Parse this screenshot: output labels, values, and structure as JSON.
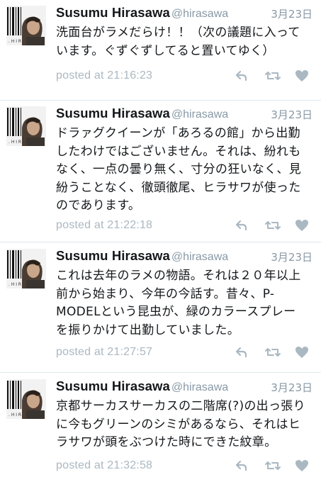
{
  "tweets": [
    {
      "name": "Susumu Hirasawa",
      "handle": "@hirasawa",
      "date": "3月23日",
      "lines": [
        "洗面台がラメだらけ！！（次の議題に入って",
        "います。ぐずぐずしてると置いてゆく）"
      ],
      "posted": "posted at 21:16:23"
    },
    {
      "name": "Susumu Hirasawa",
      "handle": "@hirasawa",
      "date": "3月23日",
      "lines": [
        "ドラァグクイーンが「あろるの館」から出勤",
        "したわけではございません。それは、紛れも",
        "なく、一点の曇り無く、寸分の狂いなく、見",
        "紛うことなく、徹頭徹尾、ヒラサワが使った",
        "のであります。"
      ],
      "posted": "posted at 21:22:18"
    },
    {
      "name": "Susumu Hirasawa",
      "handle": "@hirasawa",
      "date": "3月23日",
      "lines": [
        "これは去年のラメの物語。それは２０年以上",
        "前から始まり、今年の今話す。昔々、P-",
        "MODELという昆虫が、緑のカラースプレー",
        "を振りかけて出勤していました。"
      ],
      "posted": "posted at 21:27:57"
    },
    {
      "name": "Susumu Hirasawa",
      "handle": "@hirasawa",
      "date": "3月23日",
      "lines": [
        "京都サーカスサーカスの二階席(?)の出っ張り",
        "に今もグリーンのシミがあるなら、それはヒ",
        "ラサワが頭をぶつけた時にできた紋章。"
      ],
      "posted": "posted at 21:32:58"
    }
  ],
  "icons": {
    "avatar": "avatar-barcode-portrait",
    "reply": "reply-icon",
    "retweet": "retweet-icon",
    "like": "heart-icon"
  },
  "colors": {
    "name": "#14171a",
    "secondary": "#8899a6",
    "action": "#aab8c2",
    "separator": "#e1e8ed"
  }
}
